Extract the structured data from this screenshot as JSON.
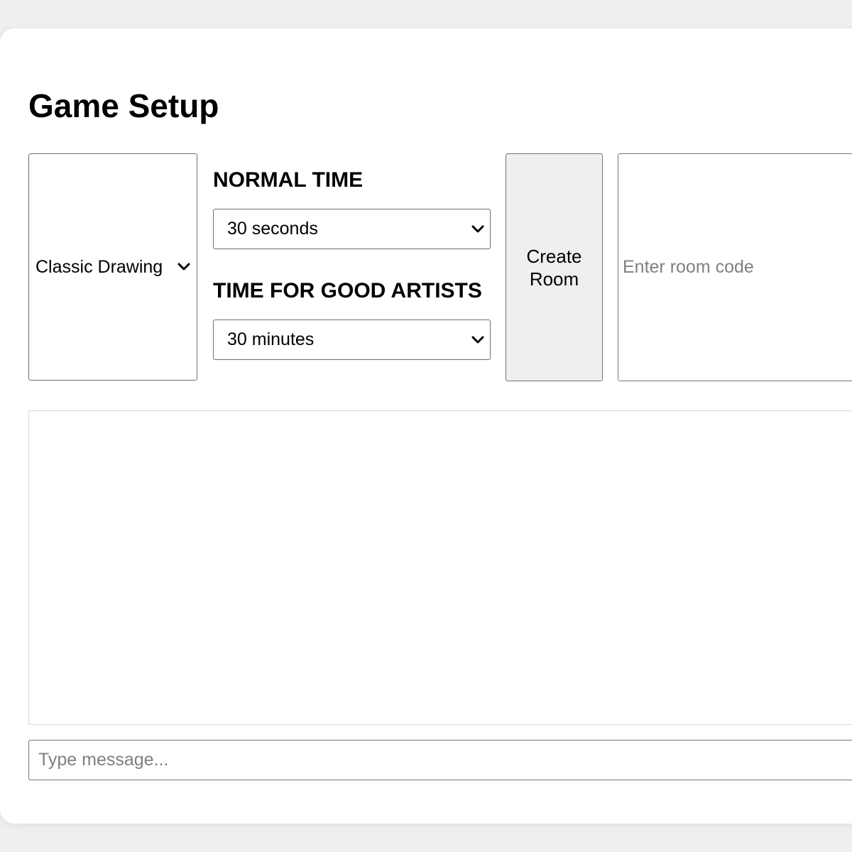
{
  "page": {
    "title": "Game Setup"
  },
  "game_mode": {
    "selected": "Classic Drawing",
    "icon": "chevron-down-icon"
  },
  "normal_time": {
    "label": "NORMAL TIME",
    "selected": "30 seconds",
    "icon": "chevron-down-icon"
  },
  "good_artists_time": {
    "label": "TIME FOR GOOD ARTISTS",
    "selected": "30 minutes",
    "icon": "chevron-down-icon"
  },
  "create_room": {
    "label": "Create Room"
  },
  "room_code": {
    "value": "",
    "placeholder": "Enter room code"
  },
  "chat": {
    "messages": [],
    "input_value": "",
    "input_placeholder": "Type message..."
  },
  "colors": {
    "background": "#efefef",
    "card": "#ffffff",
    "button_bg": "#efefef",
    "border": "#767676",
    "placeholder": "#808080"
  }
}
